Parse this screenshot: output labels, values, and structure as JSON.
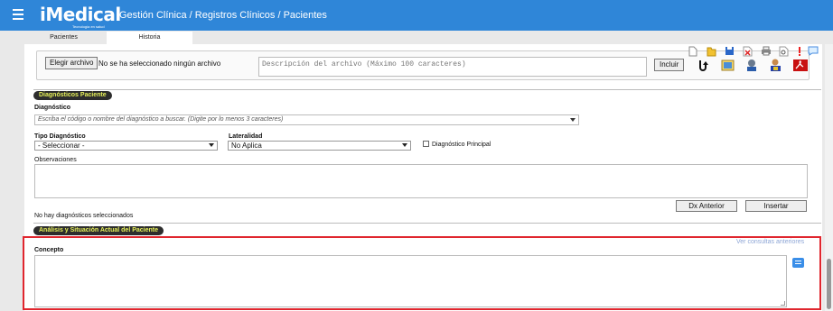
{
  "header": {
    "brand": "iMedical",
    "tagline": "Tecnología en salud",
    "breadcrumb": "Gestión Clínica  /  Registros Clínicos  /  Pacientes",
    "bar_color": "#2f86d8"
  },
  "tabs": [
    {
      "label": "Pacientes"
    },
    {
      "label": "Historia"
    }
  ],
  "attachment": {
    "choose_label": "Elegir archivo",
    "status": "No se ha seleccionado ningún archivo",
    "description_placeholder": "Descripción del archivo (Máximo 100 caracteres)",
    "include_label": "Incluir"
  },
  "toolbar_icons": [
    "new-document-icon",
    "folder-icon",
    "save-icon",
    "delete-icon",
    "print-icon",
    "preview-icon",
    "alert-icon",
    "comment-icon",
    "refresh-icon",
    "report-icon",
    "doctor-icon",
    "users-icon",
    "pdf-icon"
  ],
  "diagnostics": {
    "section_title": "Diagnósticos Paciente",
    "diagnosis_label": "Diagnóstico",
    "diagnosis_placeholder": "Escriba el código o nombre del diagnóstico a buscar. (Digite por lo menos 3 caracteres)",
    "type_label": "Tipo Diagnóstico",
    "type_value": "- Seleccionar -",
    "laterality_label": "Lateralidad",
    "laterality_value": "No Aplica",
    "principal_label": "Diagnóstico Principal",
    "observations_label": "Observaciones",
    "prev_button": "Dx Anterior",
    "insert_button": "Insertar",
    "empty_message": "No hay diagnósticos seleccionados"
  },
  "analysis": {
    "section_title": "Análisis y Situación Actual del Paciente",
    "previous_link": "Ver consultas anteriores",
    "concept_label": "Concepto",
    "highlight_color": "#e0262e"
  }
}
